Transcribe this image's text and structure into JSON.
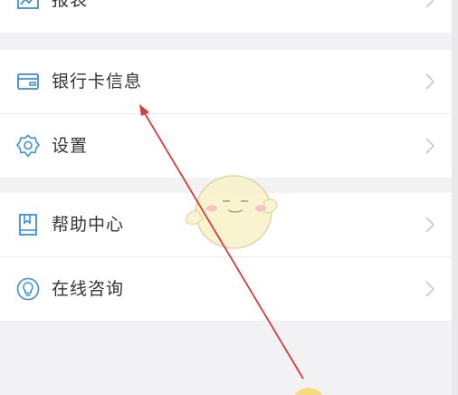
{
  "menu": {
    "groups": [
      {
        "items": [
          {
            "label": "报表",
            "icon": "chart-icon"
          }
        ]
      },
      {
        "items": [
          {
            "label": "银行卡信息",
            "icon": "bank-card-icon"
          },
          {
            "label": "设置",
            "icon": "gear-icon"
          }
        ]
      },
      {
        "items": [
          {
            "label": "帮助中心",
            "icon": "book-icon"
          },
          {
            "label": "在线咨询",
            "icon": "lightbulb-icon"
          }
        ]
      }
    ]
  },
  "colors": {
    "icon": "#3a8fd9",
    "chevron": "#c8c8c8",
    "annotation_arrow": "#d63b3b",
    "background": "#f2f2f4"
  }
}
